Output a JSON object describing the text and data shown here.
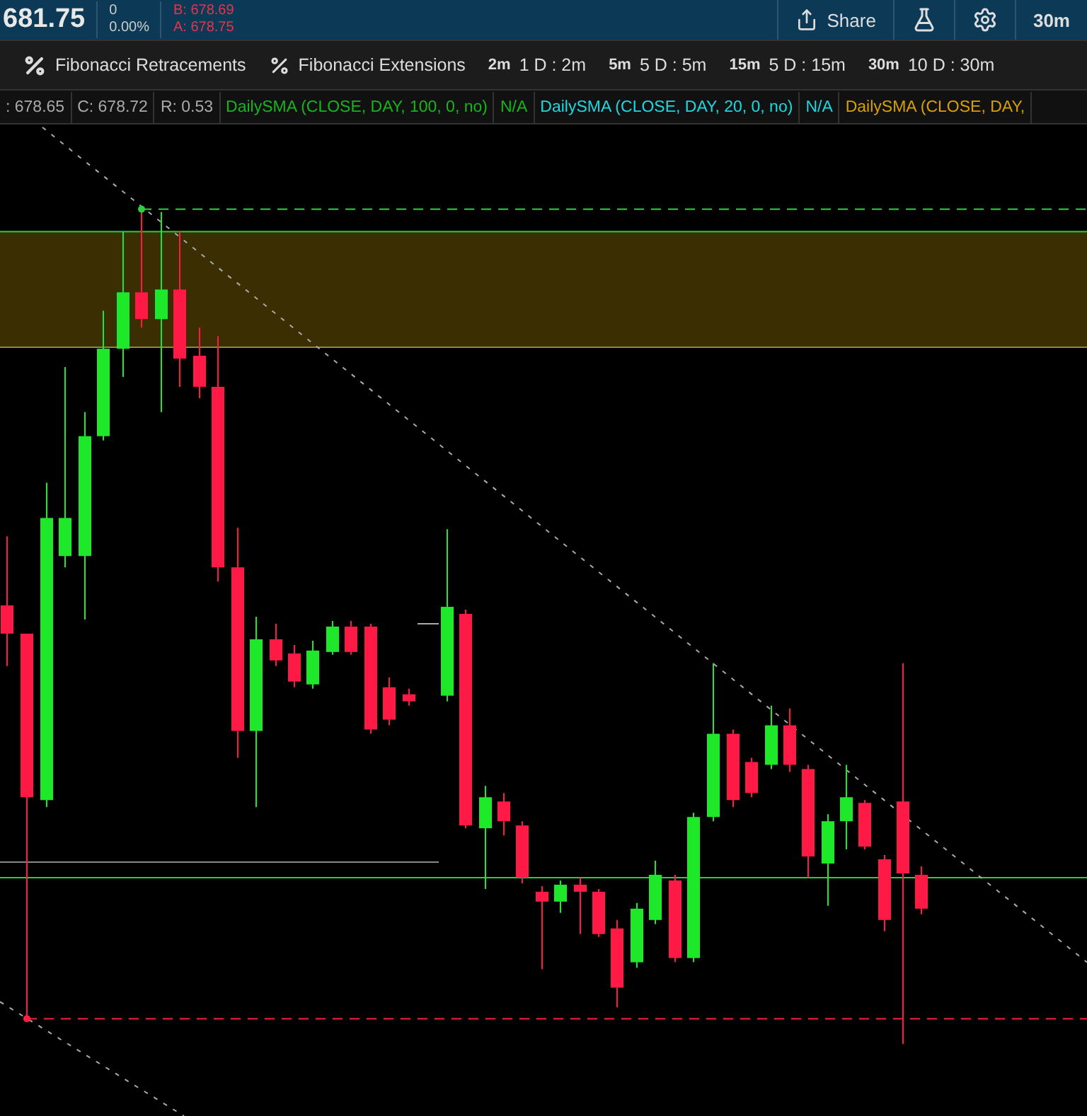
{
  "quote": {
    "price": "681.75",
    "change": "0",
    "change_pct": "0.00%",
    "bid": "B: 678.69",
    "ask": "A: 678.75"
  },
  "header_actions": [
    {
      "kind": "share",
      "label": "Share"
    },
    {
      "kind": "flask"
    },
    {
      "kind": "gear"
    },
    {
      "kind": "text",
      "label": "30m"
    }
  ],
  "toolbar": [
    {
      "kind": "retracement",
      "label": "Fibonacci Retracements"
    },
    {
      "kind": "extension",
      "label": "Fibonacci Extensions"
    },
    {
      "kind": "interval",
      "code": "2m",
      "label": "1 D : 2m"
    },
    {
      "kind": "interval",
      "code": "5m",
      "label": "5 D : 5m"
    },
    {
      "kind": "interval",
      "code": "15m",
      "label": "5 D : 15m"
    },
    {
      "kind": "interval",
      "code": "30m",
      "label": "10 D : 30m"
    }
  ],
  "studies": [
    {
      "label": ": 678.65",
      "kind": "reading"
    },
    {
      "label": "C: 678.72",
      "kind": "reading"
    },
    {
      "label": "R: 0.53",
      "kind": "reading"
    },
    {
      "label": "DailySMA (CLOSE, DAY, 100, 0, no)",
      "kind": "sma100"
    },
    {
      "label": "N/A",
      "kind": "sma100"
    },
    {
      "label": "DailySMA (CLOSE, DAY, 20, 0, no)",
      "kind": "sma20"
    },
    {
      "label": "N/A",
      "kind": "sma20"
    },
    {
      "label": "DailySMA (CLOSE, DAY,",
      "kind": "sma50"
    }
  ]
}
